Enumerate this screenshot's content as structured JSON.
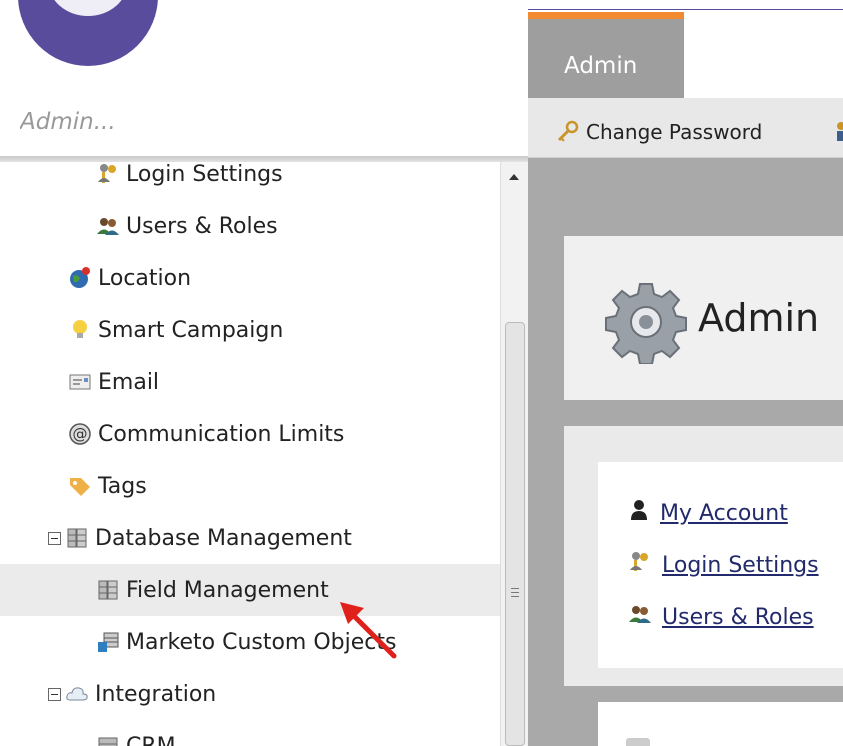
{
  "header": {
    "search_placeholder": "Admin..."
  },
  "tabs": {
    "active_tab": "Admin"
  },
  "toolbar": {
    "change_password_label": "Change Password"
  },
  "tree": {
    "items": [
      {
        "label": "Login Settings",
        "icon": "key-user-icon"
      },
      {
        "label": "Users & Roles",
        "icon": "users-icon"
      },
      {
        "label": "Location",
        "icon": "globe-icon"
      },
      {
        "label": "Smart Campaign",
        "icon": "lightbulb-icon"
      },
      {
        "label": "Email",
        "icon": "email-icon"
      },
      {
        "label": "Communication Limits",
        "icon": "at-sign-icon"
      },
      {
        "label": "Tags",
        "icon": "tag-icon"
      },
      {
        "label": "Database Management",
        "icon": "database-icon"
      },
      {
        "label": "Field Management",
        "icon": "database-icon"
      },
      {
        "label": "Marketo Custom Objects",
        "icon": "custom-objects-icon"
      },
      {
        "label": "Integration",
        "icon": "cloud-icon"
      },
      {
        "label": "CRM",
        "icon": "crm-icon"
      }
    ]
  },
  "main": {
    "title": "Admin",
    "links": [
      {
        "label": "My Account",
        "icon": "user-icon"
      },
      {
        "label": "Login Settings",
        "icon": "key-user-icon"
      },
      {
        "label": "Users & Roles",
        "icon": "users-icon"
      }
    ]
  },
  "colors": {
    "brand_purple": "#5a4c9c",
    "tab_accent_orange": "#f28b30",
    "link_color": "#222a6b",
    "annotation_arrow_red": "#e0201b"
  }
}
